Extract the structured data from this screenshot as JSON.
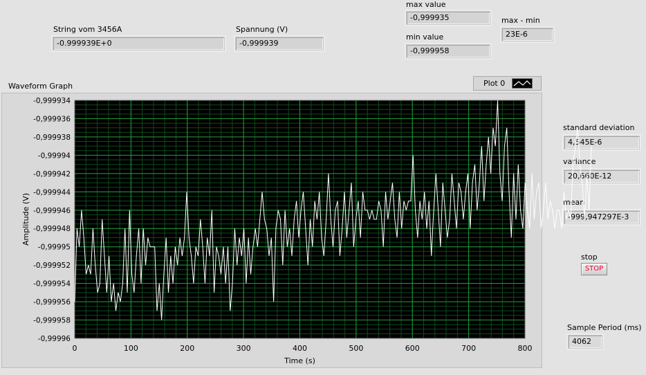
{
  "string_indicator": {
    "label": "String vom 3456A",
    "value": "-0.999939E+0"
  },
  "spannung": {
    "label": "Spannung (V)",
    "value": "-0,999939"
  },
  "max_value": {
    "label": "max value",
    "value": "-0,999935"
  },
  "min_value": {
    "label": "min value",
    "value": "-0,999958"
  },
  "max_minus_min": {
    "label": "max - min",
    "value": "23E-6"
  },
  "std_dev": {
    "label": "standard deviation",
    "value": "4,545E-6"
  },
  "variance": {
    "label": "variance",
    "value": "20,660E-12"
  },
  "mean": {
    "label": "mean",
    "value": "-999,947297E-3"
  },
  "stop": {
    "label": "stop",
    "button": "STOP"
  },
  "sample_period": {
    "label": "Sample Period (ms)",
    "value": "4062"
  },
  "graph": {
    "title": "Waveform Graph",
    "legend_plot": "Plot 0"
  },
  "colors": {
    "plot_bg": "#000000",
    "grid_major": "#1f9a3a",
    "grid_minor": "#0f4a1c",
    "trace": "#ffffff",
    "stop_text": "#e6002b"
  },
  "chart_data": {
    "type": "line",
    "xlabel": "Time (s)",
    "ylabel": "Amplitude (V)",
    "xlim": [
      0,
      800
    ],
    "ylim": [
      -0.99996,
      -0.999934
    ],
    "x_ticks": [
      0,
      100,
      200,
      300,
      400,
      500,
      600,
      700,
      800
    ],
    "x_tick_labels": [
      "0",
      "100",
      "200",
      "300",
      "400",
      "500",
      "600",
      "700",
      "800"
    ],
    "y_ticks": [
      -0.999934,
      -0.999936,
      -0.999938,
      -0.99994,
      -0.999942,
      -0.999944,
      -0.999946,
      -0.999948,
      -0.99995,
      -0.999952,
      -0.999954,
      -0.999956,
      -0.999958,
      -0.99996
    ],
    "y_tick_labels": [
      "-0,999934",
      "-0,999936",
      "-0,999938",
      "-0,99994",
      "-0,999942",
      "-0,999944",
      "-0,999946",
      "-0,999948",
      "-0,99995",
      "-0,999952",
      "-0,999954",
      "-0,999956",
      "-0,999958",
      "-0,99996"
    ],
    "grid": true,
    "series": [
      {
        "x_step": 4.062,
        "values": [
          -0.999956,
          -0.999948,
          -0.99995,
          -0.999946,
          -0.999949,
          -0.999953,
          -0.999952,
          -0.999953,
          -0.999948,
          -0.999952,
          -0.999955,
          -0.999954,
          -0.999947,
          -0.999951,
          -0.999955,
          -0.999951,
          -0.999956,
          -0.999954,
          -0.999957,
          -0.999955,
          -0.999956,
          -0.999954,
          -0.999948,
          -0.999955,
          -0.999946,
          -0.999953,
          -0.999955,
          -0.999951,
          -0.999948,
          -0.999954,
          -0.999948,
          -0.999952,
          -0.999949,
          -0.99995,
          -0.99995,
          -0.99995,
          -0.999957,
          -0.999954,
          -0.999958,
          -0.999953,
          -0.999949,
          -0.999955,
          -0.999951,
          -0.999954,
          -0.99995,
          -0.999952,
          -0.999949,
          -0.999951,
          -0.999949,
          -0.999944,
          -0.999949,
          -0.999951,
          -0.999954,
          -0.99995,
          -0.999951,
          -0.999947,
          -0.99995,
          -0.999954,
          -0.999949,
          -0.999951,
          -0.999946,
          -0.999955,
          -0.99995,
          -0.999951,
          -0.999953,
          -0.99995,
          -0.999954,
          -0.99995,
          -0.999957,
          -0.999954,
          -0.999948,
          -0.999952,
          -0.999949,
          -0.999951,
          -0.999948,
          -0.999954,
          -0.999949,
          -0.999953,
          -0.99995,
          -0.999948,
          -0.99995,
          -0.999947,
          -0.999944,
          -0.999947,
          -0.999948,
          -0.999951,
          -0.999949,
          -0.999956,
          -0.999948,
          -0.999946,
          -0.999947,
          -0.999952,
          -0.999946,
          -0.99995,
          -0.999948,
          -0.999951,
          -0.999947,
          -0.999945,
          -0.999949,
          -0.999946,
          -0.999944,
          -0.999948,
          -0.999952,
          -0.999947,
          -0.99995,
          -0.999945,
          -0.999947,
          -0.999944,
          -0.999949,
          -0.999951,
          -0.999947,
          -0.999942,
          -0.999947,
          -0.99995,
          -0.999946,
          -0.999945,
          -0.999951,
          -0.999948,
          -0.999944,
          -0.999949,
          -0.999946,
          -0.999943,
          -0.99995,
          -0.999947,
          -0.999945,
          -0.999949,
          -0.999944,
          -0.999946,
          -0.999946,
          -0.999947,
          -0.999946,
          -0.999947,
          -0.999947,
          -0.999945,
          -0.999946,
          -0.99995,
          -0.999944,
          -0.999947,
          -0.999945,
          -0.999943,
          -0.999947,
          -0.999949,
          -0.999944,
          -0.999948,
          -0.999945,
          -0.999946,
          -0.999945,
          -0.999945,
          -0.99994,
          -0.999946,
          -0.999949,
          -0.999945,
          -0.999947,
          -0.999944,
          -0.999948,
          -0.999945,
          -0.999951,
          -0.999946,
          -0.999942,
          -0.999946,
          -0.99995,
          -0.999943,
          -0.999946,
          -0.999949,
          -0.999947,
          -0.999942,
          -0.999945,
          -0.999948,
          -0.999943,
          -0.999944,
          -0.999947,
          -0.999944,
          -0.999942,
          -0.999948,
          -0.999943,
          -0.999941,
          -0.999946,
          -0.999943,
          -0.999939,
          -0.999945,
          -0.999941,
          -0.999938,
          -0.999942,
          -0.999937,
          -0.999939,
          -0.999934,
          -0.999942,
          -0.999945,
          -0.999939,
          -0.999937,
          -0.999944,
          -0.999949,
          -0.999942,
          -0.999947,
          -0.999941,
          -0.999946,
          -0.999948,
          -0.999943,
          -0.999946,
          -0.999948,
          -0.999942,
          -0.999947,
          -0.999944,
          -0.999943,
          -0.999948,
          -0.999946,
          -0.999943,
          -0.999947,
          -0.999945,
          -0.999946,
          -0.999948,
          -0.999946,
          -0.999946,
          -0.999948,
          -0.999944,
          -0.999947,
          -0.999946,
          -0.999947,
          -0.999941,
          -0.999939,
          -0.999937,
          -0.999941,
          -0.999943,
          -0.999947,
          -0.999942,
          -0.999946,
          -0.999939
        ]
      }
    ]
  }
}
